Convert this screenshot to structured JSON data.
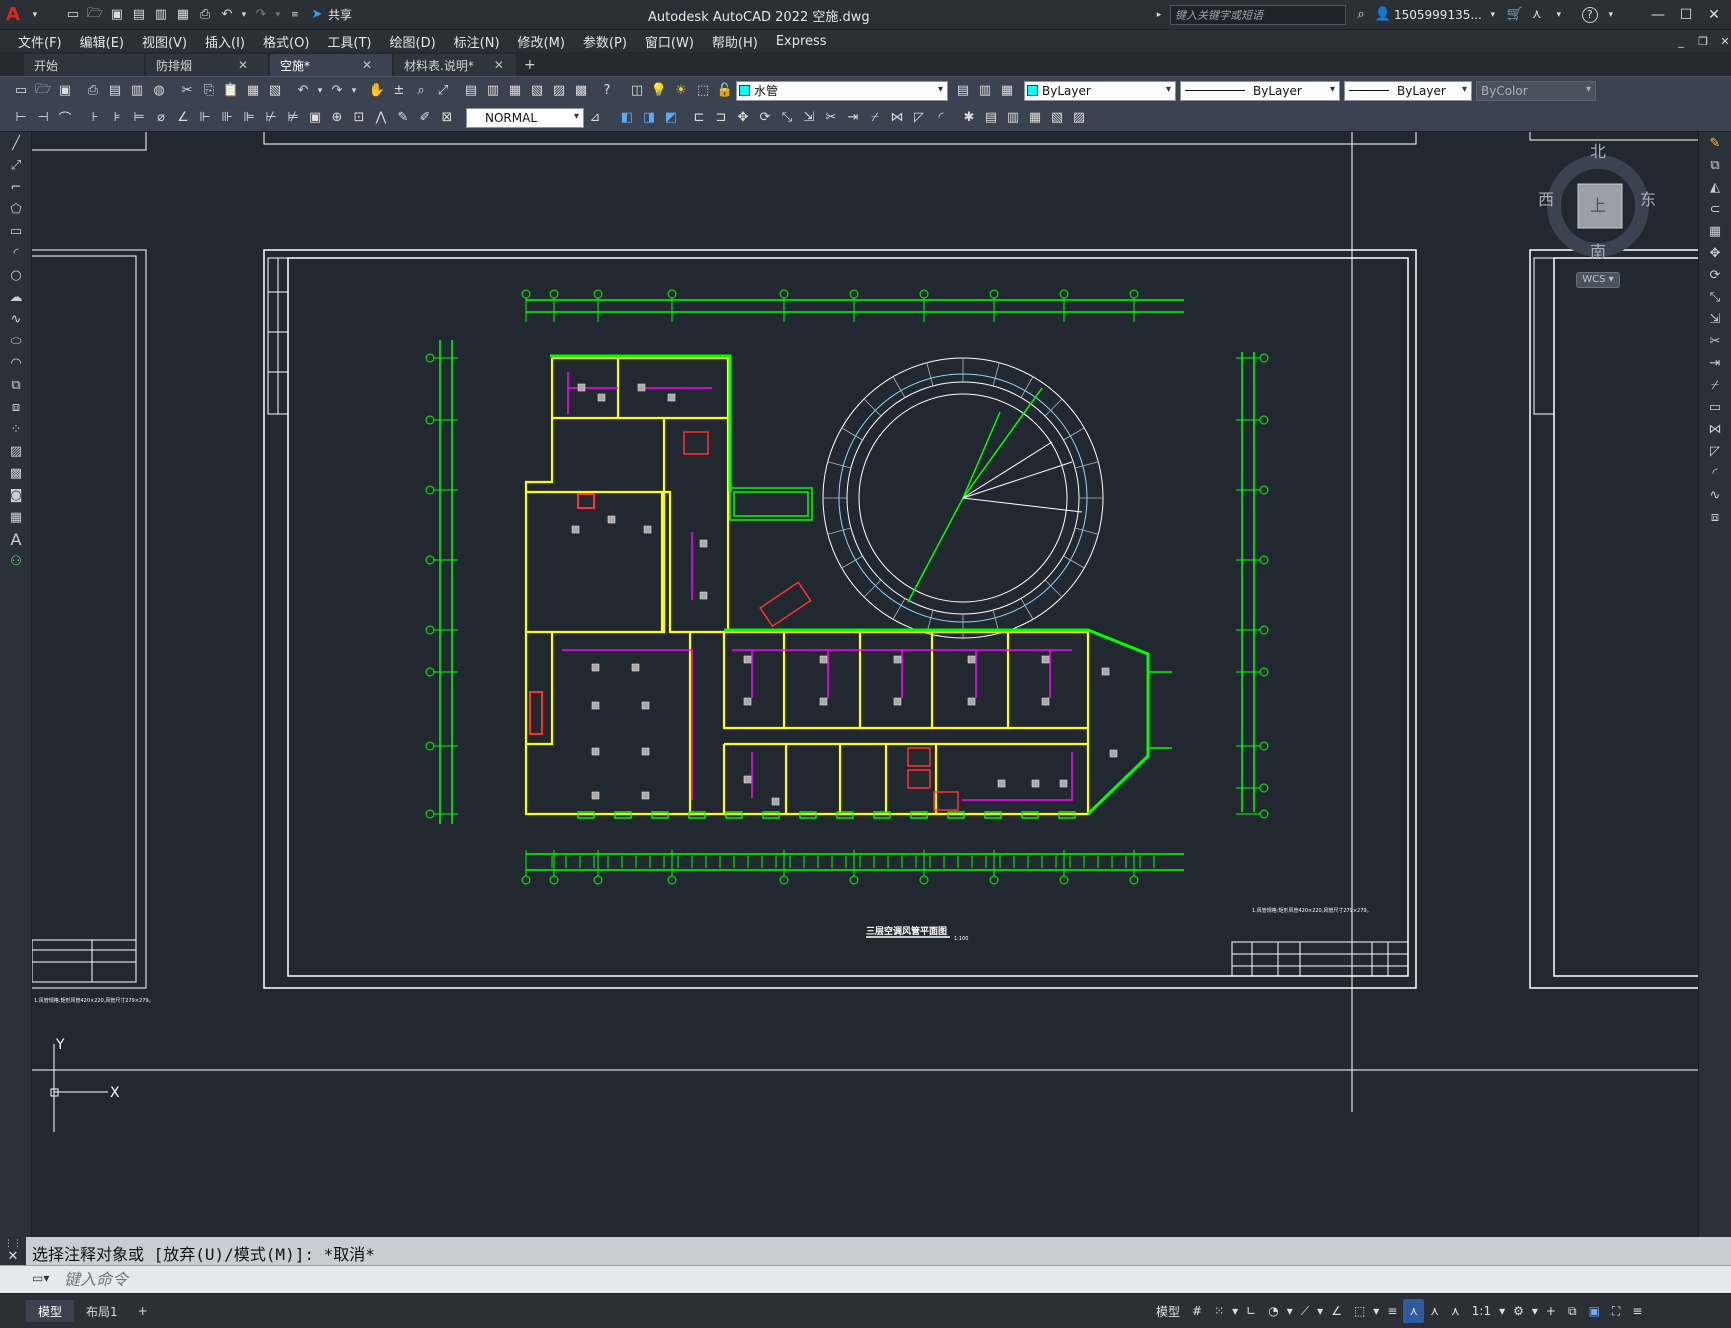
{
  "titlebar": {
    "share_label": "共享",
    "title": "Autodesk AutoCAD 2022    空施.dwg",
    "search_placeholder": "键入关键字或短语",
    "user": "1505999135...",
    "help": "?"
  },
  "menu": [
    "文件(F)",
    "编辑(E)",
    "视图(V)",
    "插入(I)",
    "格式(O)",
    "工具(T)",
    "绘图(D)",
    "标注(N)",
    "修改(M)",
    "参数(P)",
    "窗口(W)",
    "帮助(H)",
    "Express"
  ],
  "tabs": [
    {
      "label": "开始",
      "closable": false,
      "active": false
    },
    {
      "label": "防排烟",
      "closable": true,
      "active": false
    },
    {
      "label": "空施*",
      "closable": true,
      "active": true
    },
    {
      "label": "材料表.说明*",
      "closable": true,
      "active": false
    }
  ],
  "toolbar": {
    "layer": "水管",
    "color": "ByLayer",
    "linetype": "ByLayer",
    "lineweight": "ByLayer",
    "plotstyle": "ByColor",
    "dimstyle": "NORMAL"
  },
  "viewcube": {
    "north": "北",
    "south": "南",
    "east": "东",
    "west": "西",
    "face": "上",
    "ucs": "WCS"
  },
  "drawing": {
    "plan_title": "三层空调风管平面图",
    "scale": "1:100",
    "note": "1.风管规格:矩形风管420×220,风管尺寸279×279。",
    "left_note": "1.风管规格:矩形风管420×220,风管尺寸279×279。",
    "ucs_x": "X",
    "ucs_y": "Y"
  },
  "command": {
    "history": "选择注释对象或 [放弃(U)/模式(M)]: *取消*",
    "placeholder": "键入命令"
  },
  "status": {
    "layouts": [
      "模型",
      "布局1"
    ],
    "model_label": "模型",
    "scale": "1:1"
  },
  "colors": {
    "green": "#00ff00",
    "yellow": "#ffff00",
    "magenta": "#ff00ff",
    "white": "#ffffff",
    "red": "#ff0000",
    "cyan": "#7fd4ff",
    "canvas": "#212830"
  }
}
